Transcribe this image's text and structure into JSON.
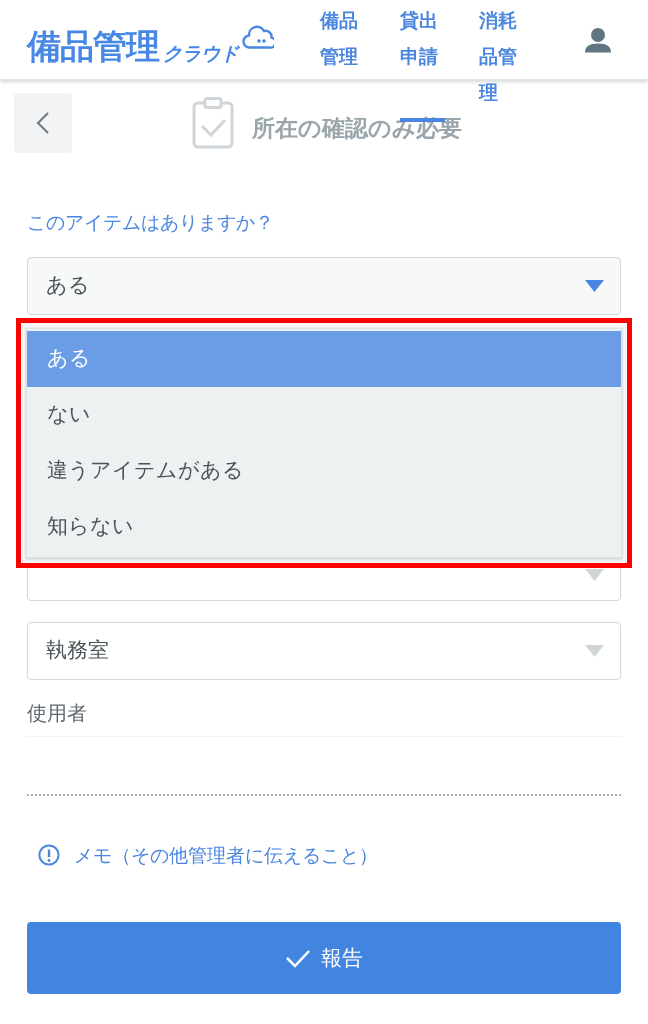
{
  "header": {
    "logo": {
      "title": "備品管理",
      "subtitle": "クラウド"
    },
    "nav": [
      {
        "label": "備品管理",
        "selected": false
      },
      {
        "label": "貸出申請",
        "selected": true
      },
      {
        "label": "消耗品管理",
        "selected": false
      }
    ]
  },
  "page": {
    "title": "所在の確認のみ必要"
  },
  "form": {
    "question": {
      "label": "このアイテムはありますか？",
      "value": "ある",
      "open": true,
      "highlighted": true,
      "options": [
        {
          "label": "ある",
          "selected": true
        },
        {
          "label": "ない",
          "selected": false
        },
        {
          "label": "違うアイテムがある",
          "selected": false
        },
        {
          "label": "知らない",
          "selected": false
        }
      ]
    },
    "fields": [
      {
        "kind": "select"
      },
      {
        "kind": "select",
        "value": "執務室"
      },
      {
        "kind": "text",
        "label": "使用者"
      }
    ],
    "memo_link": "メモ（その他管理者に伝えること）",
    "submit": "報告"
  }
}
